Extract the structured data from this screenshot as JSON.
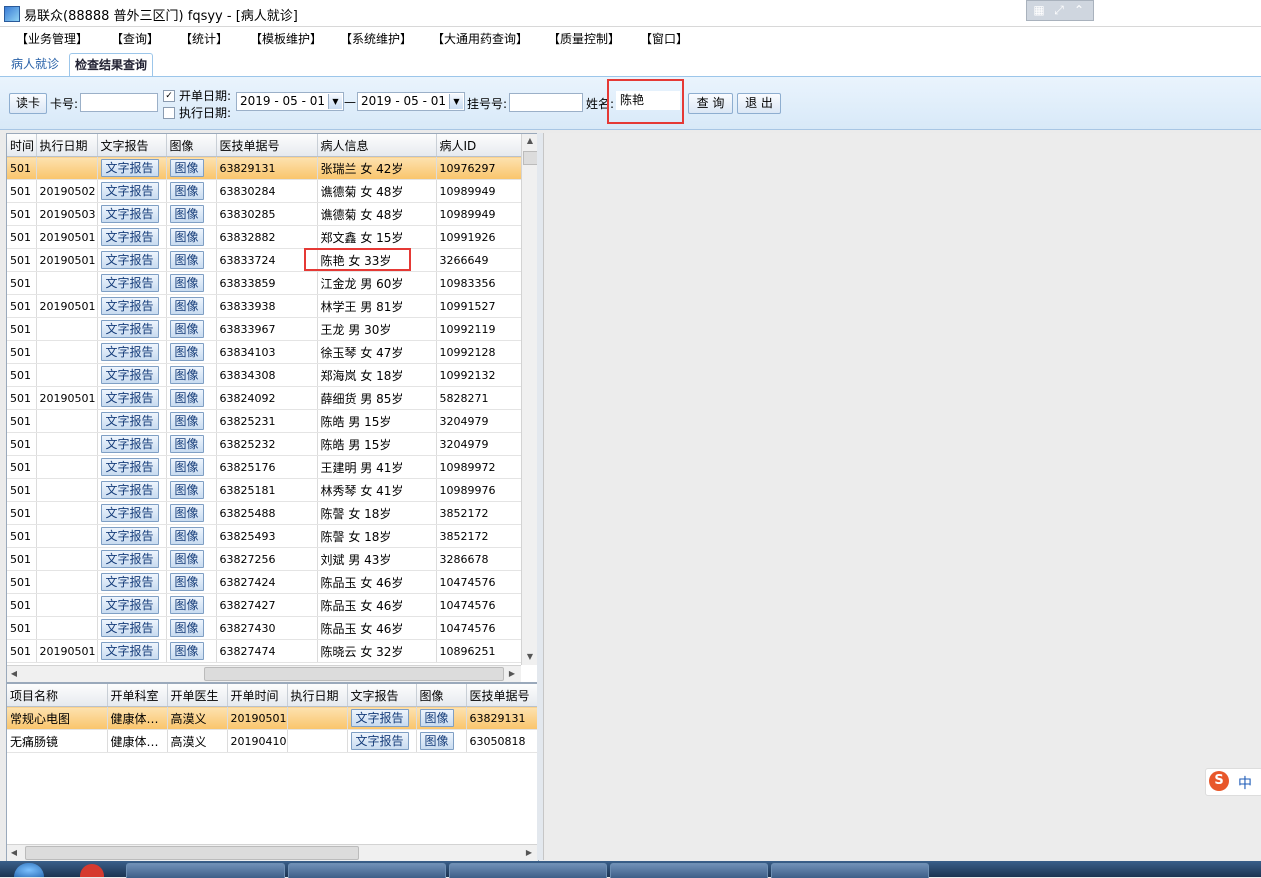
{
  "window": {
    "title": "易联众(88888 普外三区门) fqsyy - [病人就诊]"
  },
  "menu": [
    "【业务管理】",
    "【查询】",
    "【统计】",
    "【模板维护】",
    "【系统维护】",
    "【大通用药查询】",
    "【质量控制】",
    "【窗口】"
  ],
  "tabs": {
    "inactive": "病人就诊",
    "active": "检查结果查询"
  },
  "toolbar": {
    "read_card": "读卡",
    "card_label": "卡号:",
    "card_value": "",
    "order_date_label": "开单日期:",
    "exec_date_label": "执行日期:",
    "date_from": "2019 - 05 - 01",
    "date_sep": "—",
    "date_to": "2019 - 05 - 01",
    "reg_label": "挂号号:",
    "reg_value": "",
    "name_label": "姓名:",
    "name_value": "陈艳",
    "query": "查 询",
    "exit": "退 出"
  },
  "grid": {
    "columns": [
      "时间",
      "执行日期",
      "文字报告",
      "图像",
      "医技单据号",
      "病人信息",
      "病人ID"
    ],
    "report_btn": "文字报告",
    "image_btn": "图像",
    "rows": [
      {
        "time": "501",
        "exec": "",
        "doc": "63829131",
        "info": "张瑞兰 女 42岁",
        "pid": "10976297"
      },
      {
        "time": "501",
        "exec": "20190502",
        "doc": "63830284",
        "info": "谯德菊 女 48岁",
        "pid": "10989949"
      },
      {
        "time": "501",
        "exec": "20190503",
        "doc": "63830285",
        "info": "谯德菊 女 48岁",
        "pid": "10989949"
      },
      {
        "time": "501",
        "exec": "20190501",
        "doc": "63832882",
        "info": "郑文鑫 女 15岁",
        "pid": "10991926"
      },
      {
        "time": "501",
        "exec": "20190501",
        "doc": "63833724",
        "info": "陈艳 女 33岁",
        "pid": "3266649"
      },
      {
        "time": "501",
        "exec": "",
        "doc": "63833859",
        "info": "江金龙 男 60岁",
        "pid": "10983356"
      },
      {
        "time": "501",
        "exec": "20190501",
        "doc": "63833938",
        "info": "林学王 男 81岁",
        "pid": "10991527"
      },
      {
        "time": "501",
        "exec": "",
        "doc": "63833967",
        "info": "王龙 男 30岁",
        "pid": "10992119"
      },
      {
        "time": "501",
        "exec": "",
        "doc": "63834103",
        "info": "徐玉琴 女 47岁",
        "pid": "10992128"
      },
      {
        "time": "501",
        "exec": "",
        "doc": "63834308",
        "info": "郑海岚 女 18岁",
        "pid": "10992132"
      },
      {
        "time": "501",
        "exec": "20190501",
        "doc": "63824092",
        "info": "薛细货 男 85岁",
        "pid": "5828271"
      },
      {
        "time": "501",
        "exec": "",
        "doc": "63825231",
        "info": "陈皓 男 15岁",
        "pid": "3204979"
      },
      {
        "time": "501",
        "exec": "",
        "doc": "63825232",
        "info": "陈皓 男 15岁",
        "pid": "3204979"
      },
      {
        "time": "501",
        "exec": "",
        "doc": "63825176",
        "info": "王建明 男 41岁",
        "pid": "10989972"
      },
      {
        "time": "501",
        "exec": "",
        "doc": "63825181",
        "info": "林秀琴 女 41岁",
        "pid": "10989976"
      },
      {
        "time": "501",
        "exec": "",
        "doc": "63825488",
        "info": "陈謦 女 18岁",
        "pid": "3852172"
      },
      {
        "time": "501",
        "exec": "",
        "doc": "63825493",
        "info": "陈謦 女 18岁",
        "pid": "3852172"
      },
      {
        "time": "501",
        "exec": "",
        "doc": "63827256",
        "info": "刘斌 男 43岁",
        "pid": "3286678"
      },
      {
        "time": "501",
        "exec": "",
        "doc": "63827424",
        "info": "陈品玉 女 46岁",
        "pid": "10474576"
      },
      {
        "time": "501",
        "exec": "",
        "doc": "63827427",
        "info": "陈品玉 女 46岁",
        "pid": "10474576"
      },
      {
        "time": "501",
        "exec": "",
        "doc": "63827430",
        "info": "陈品玉 女 46岁",
        "pid": "10474576"
      },
      {
        "time": "501",
        "exec": "20190501",
        "doc": "63827474",
        "info": "陈晓云 女 32岁",
        "pid": "10896251"
      }
    ]
  },
  "detail": {
    "columns": [
      "项目名称",
      "开单科室",
      "开单医生",
      "开单时间",
      "执行日期",
      "文字报告",
      "图像",
      "医技单据号"
    ],
    "rows": [
      {
        "item": "常规心电图",
        "dept": "健康体…",
        "doctor": "高漠义",
        "time": "20190501",
        "exec": "",
        "doc": "63829131"
      },
      {
        "item": "无痛肠镜",
        "dept": "健康体…",
        "doctor": "高漠义",
        "time": "20190410",
        "exec": "",
        "doc": "63050818"
      }
    ]
  },
  "ime": {
    "label": "中"
  },
  "colors": {
    "selected_row": "#f9c46b",
    "highlight_box": "#e53935"
  }
}
